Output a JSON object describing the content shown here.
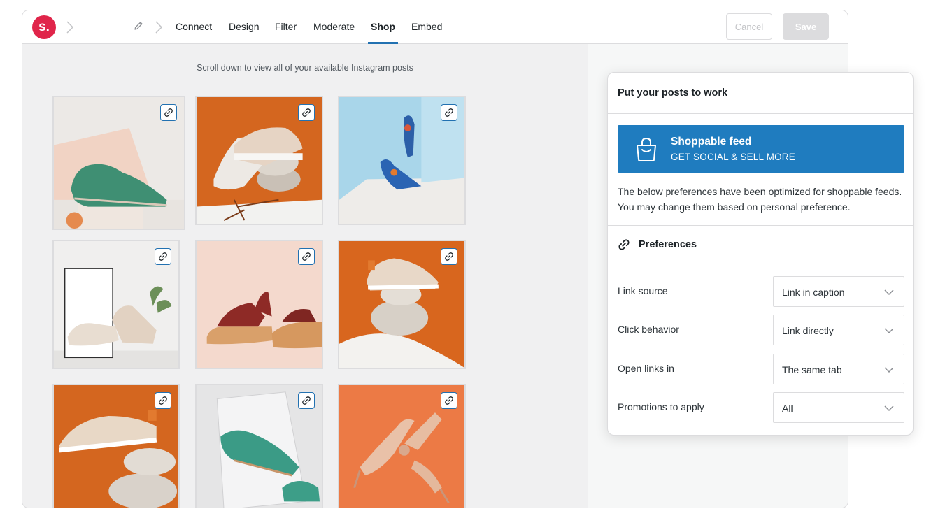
{
  "app": {
    "logo_text": "s."
  },
  "nav": {
    "tabs": [
      {
        "label": "Connect"
      },
      {
        "label": "Design"
      },
      {
        "label": "Filter"
      },
      {
        "label": "Moderate"
      },
      {
        "label": "Shop",
        "active": true
      },
      {
        "label": "Embed"
      }
    ],
    "cancel_label": "Cancel",
    "save_label": "Save"
  },
  "content": {
    "hint": "Scroll down to view all of your available Instagram posts",
    "posts_icon": "link-icon"
  },
  "panel": {
    "title": "Put your posts to work",
    "feed_title": "Shoppable feed",
    "feed_subtitle": "GET SOCIAL & SELL MORE",
    "description": "The below preferences have been optimized for shoppable feeds. You may change them based on personal preference.",
    "preferences_title": "Preferences",
    "rows": [
      {
        "label": "Link source",
        "value": "Link in caption"
      },
      {
        "label": "Click behavior",
        "value": "Link directly"
      },
      {
        "label": "Open links in",
        "value": "The same tab"
      },
      {
        "label": "Promotions to apply",
        "value": "All"
      }
    ]
  },
  "colors": {
    "accent": "#2271b1",
    "brand": "#e0254a",
    "feed_card": "#1f7cbf"
  }
}
